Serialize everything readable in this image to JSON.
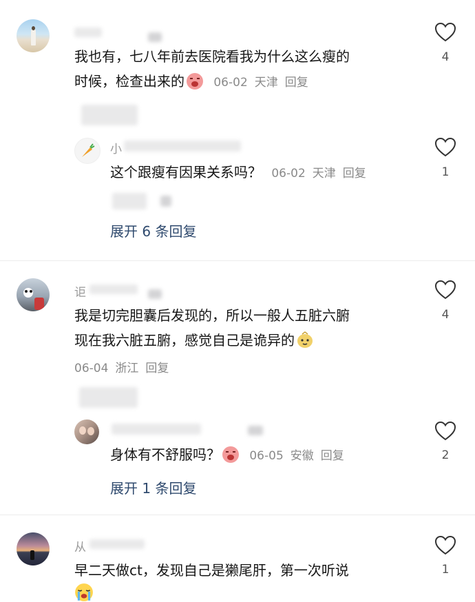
{
  "comments": [
    {
      "text_line1": "我也有，七八年前去医院看我为什么这么瘦的",
      "text_line2": "时候，检查出来的",
      "date": "06-02",
      "location": "天津",
      "reply": "回复",
      "likes": "4",
      "emoji": "crying-face-icon"
    },
    {
      "username": "小",
      "text": "这个跟瘦有因果关系吗？",
      "date": "06-02",
      "location": "天津",
      "reply": "回复",
      "likes": "1"
    },
    {
      "expand": "展开 6 条回复"
    },
    {
      "username": "讵",
      "text_line1": "我是切完胆囊后发现的，所以一般人五脏六腑",
      "text_line2": "现在我六脏五腑，感觉自己是诡异的",
      "date": "06-04",
      "location": "浙江",
      "reply": "回复",
      "likes": "4",
      "emoji": "weird-face-icon"
    },
    {
      "text": "身体有不舒服吗？",
      "date": "06-05",
      "location": "安徽",
      "reply": "回复",
      "likes": "2",
      "emoji": "crying-face-icon"
    },
    {
      "expand": "展开 1 条回复"
    },
    {
      "username": "从",
      "text": "早二天做ct，发现自己是獭尾肝，第一次听说",
      "likes": "1",
      "emoji": "sobbing-face-icon"
    }
  ],
  "colors": {
    "meta": "#8a8a8a",
    "expand_link": "#2f4a6e",
    "divider": "#ececec"
  }
}
